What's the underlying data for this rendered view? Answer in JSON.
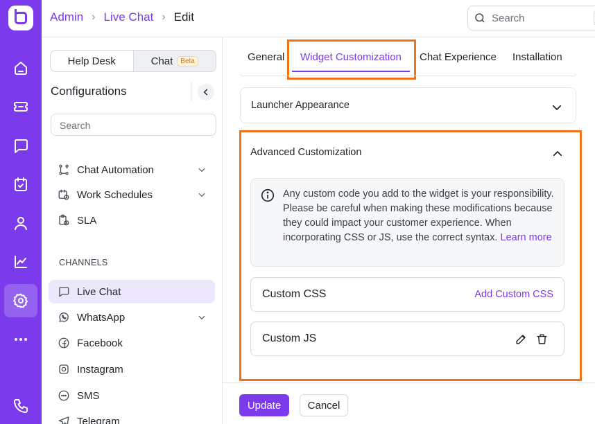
{
  "breadcrumb": {
    "items": [
      "Admin",
      "Live Chat"
    ],
    "current": "Edit"
  },
  "search": {
    "placeholder": "Search",
    "shortcut": "/"
  },
  "rail": {
    "icons": [
      "home-icon",
      "ticket-icon",
      "chat-icon",
      "calendar-check-icon",
      "user-icon",
      "chart-icon",
      "settings-icon",
      "more-icon",
      "phone-icon"
    ],
    "active": "settings-icon"
  },
  "sidebar": {
    "toggle": {
      "help_desk": "Help Desk",
      "chat": "Chat",
      "beta": "Beta"
    },
    "title": "Configurations",
    "search_placeholder": "Search",
    "items": [
      {
        "label": "Chat Automation",
        "icon": "automation-icon",
        "expandable": true
      },
      {
        "label": "Work Schedules",
        "icon": "calendar-clock-icon",
        "expandable": true
      },
      {
        "label": "SLA",
        "icon": "sla-icon",
        "expandable": false
      }
    ],
    "channels_label": "CHANNELS",
    "channels": [
      {
        "label": "Live Chat",
        "icon": "chat-bubble-icon",
        "active": true
      },
      {
        "label": "WhatsApp",
        "icon": "whatsapp-icon",
        "expandable": true
      },
      {
        "label": "Facebook",
        "icon": "facebook-icon"
      },
      {
        "label": "Instagram",
        "icon": "instagram-icon"
      },
      {
        "label": "SMS",
        "icon": "sms-icon"
      },
      {
        "label": "Telegram",
        "icon": "telegram-icon"
      }
    ]
  },
  "tabs": [
    {
      "label": "General"
    },
    {
      "label": "Widget Customization",
      "active": true
    },
    {
      "label": "Chat Experience"
    },
    {
      "label": "Installation"
    }
  ],
  "launcher": {
    "title": "Launcher Appearance"
  },
  "advanced": {
    "title": "Advanced Customization",
    "info_text": "Any custom code you add to the widget is your responsibility. Please be careful when making these modifications because they could impact your customer experience. When incorporating CSS or JS, use the correct syntax.",
    "learn_more": "Learn more",
    "css": {
      "label": "Custom CSS",
      "action": "Add Custom CSS"
    },
    "js": {
      "label": "Custom JS"
    }
  },
  "footer": {
    "update": "Update",
    "cancel": "Cancel"
  },
  "colors": {
    "accent": "#7c3aed",
    "highlight": "#f07416"
  }
}
